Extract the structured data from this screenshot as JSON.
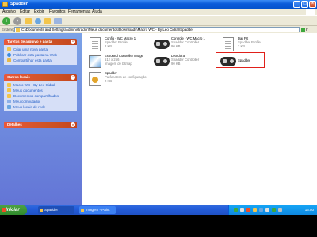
{
  "window": {
    "title": "Spadder"
  },
  "menubar": {
    "items": [
      "Arquivo",
      "Editar",
      "Exibir",
      "Favoritos",
      "Ferramentas",
      "Ajuda"
    ]
  },
  "address": {
    "label": "Endereço",
    "path": "C:\\Documents and Settings\\Administrador\\Meus documentos\\Downloads\\Macro WC - By Leo Cidral\\Spadder",
    "go": "Ir"
  },
  "left_pane": {
    "tasks_panel": {
      "title": "Tarefas de arquivo e pasta",
      "items": [
        "Criar uma nova pasta",
        "Publicar esta pasta na Web",
        "Compartilhar esta pasta"
      ]
    },
    "places_panel": {
      "title": "Outros locais",
      "items": [
        "Macro WC - By Leo Cidral",
        "Meus documentos",
        "Documentos compartilhados",
        "Meu computador",
        "Meus locais de rede"
      ]
    },
    "details_panel": {
      "title": "Detalhes"
    }
  },
  "files": [
    {
      "name": "Config - WC Macro 1",
      "type": "Spadder Profile",
      "size": "2 KB",
      "icon": "document-icon"
    },
    {
      "name": "Controle - WC Macro 1",
      "type": "Spadder Controller",
      "size": "90 KB",
      "icon": "gamepad-icon"
    },
    {
      "name": "Dar FX",
      "type": "Spadder Profile",
      "size": "2 KB",
      "icon": "document-icon"
    },
    {
      "name": "Exported Controller Image",
      "type": "512 x 256",
      "size": "Imagem de bitmap",
      "icon": "image-icon"
    },
    {
      "name": "LeoCidral",
      "type": "Spadder Controller",
      "size": "90 KB",
      "icon": "gamepad-icon"
    },
    {
      "name": "Spadder",
      "type": "",
      "size": "",
      "icon": "gamepad-icon"
    },
    {
      "name": "Spadder",
      "type": "Parâmetros de configuração",
      "size": "2 KB",
      "icon": "config-icon"
    }
  ],
  "taskbar": {
    "start_label": "Iniciar",
    "buttons": [
      "Spadder",
      "Imagem - Paint"
    ],
    "clock": "16:50"
  }
}
